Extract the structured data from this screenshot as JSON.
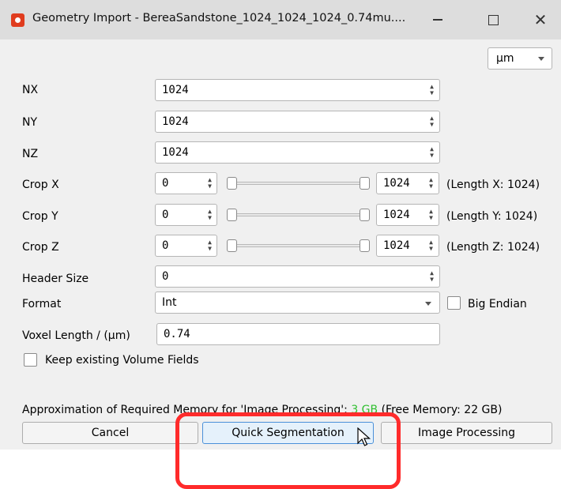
{
  "window": {
    "title": "Geometry Import - BereaSandstone_1024_1024_1024_0.74mu....",
    "icons": {
      "app": "app-logo-icon",
      "minimize": "minimize-icon",
      "maximize": "maximize-icon",
      "close": "close-icon"
    }
  },
  "unit_selector": {
    "value": "µm",
    "icon": "chevron-down-icon"
  },
  "dimensions": [
    {
      "label": "NX",
      "value": "1024"
    },
    {
      "label": "NY",
      "value": "1024"
    },
    {
      "label": "NZ",
      "value": "1024"
    }
  ],
  "crop": [
    {
      "label": "Crop X",
      "start": "0",
      "end": "1024",
      "length_text": "(Length X: 1024)",
      "range_fraction": [
        0,
        1
      ]
    },
    {
      "label": "Crop Y",
      "start": "0",
      "end": "1024",
      "length_text": "(Length Y: 1024)",
      "range_fraction": [
        0,
        1
      ]
    },
    {
      "label": "Crop Z",
      "start": "0",
      "end": "1024",
      "length_text": "(Length Z: 1024)",
      "range_fraction": [
        0,
        1
      ]
    }
  ],
  "header_size": {
    "label": "Header Size",
    "value": "0"
  },
  "format": {
    "label": "Format",
    "value": "Int",
    "big_endian_label": "Big Endian",
    "big_endian_checked": false
  },
  "voxel_length": {
    "label": "Voxel Length / (µm)",
    "value": "0.74"
  },
  "keep_fields": {
    "label": "Keep existing Volume Fields",
    "checked": false
  },
  "memory": {
    "prefix": "Approximation of Required Memory for 'Image Processing': ",
    "required": "3 GB",
    "suffix": " (Free Memory: 22 GB)",
    "required_color": "#2fbf2f"
  },
  "buttons": {
    "cancel": "Cancel",
    "quick_segmentation": "Quick Segmentation",
    "image_processing": "Image Processing"
  },
  "annotation": {
    "highlight_color": "#ff2b2b",
    "cursor_icon": "mouse-pointer-icon"
  }
}
